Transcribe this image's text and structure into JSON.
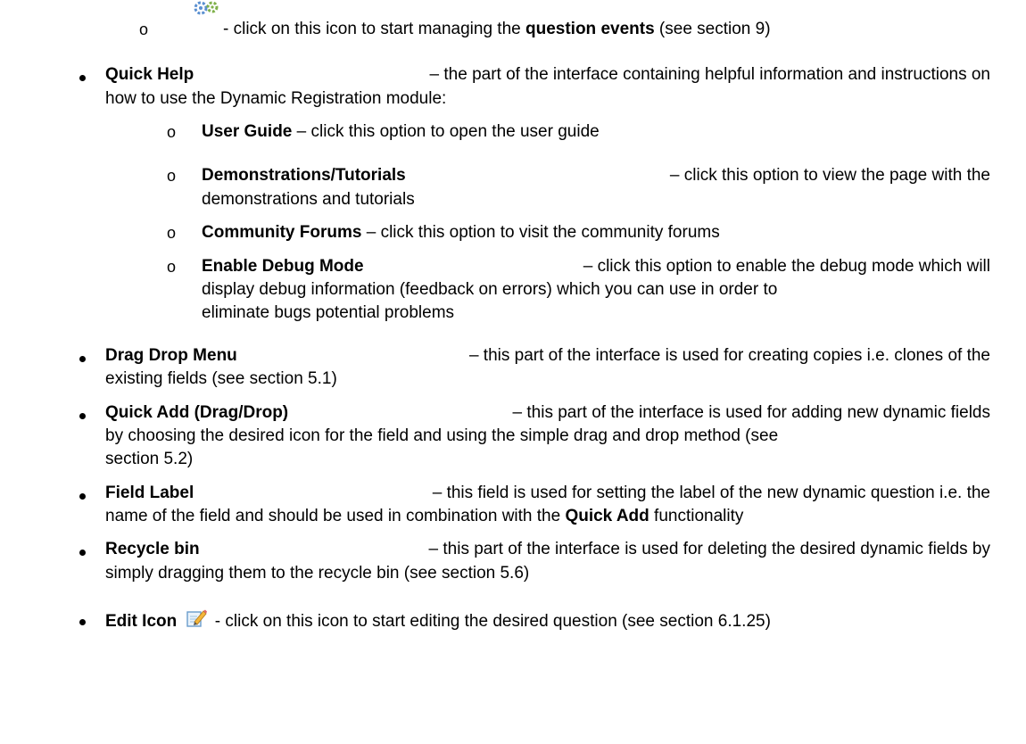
{
  "items": {
    "question_events": {
      "text": "- click on this icon to start managing the ",
      "bold": "question events",
      "tail": " (see section 9)"
    },
    "quick_help": {
      "title": "Quick Help",
      "line1": "– the part of the interface containing helpful information and instructions on",
      "line2": "how to use the Dynamic Registration module:",
      "subitems": {
        "user_guide": {
          "title": "User Guide",
          "text": "– click this option to open the user guide"
        },
        "demos": {
          "title": "Demonstrations/Tutorials",
          "line1": "– click this option to view the page with the",
          "line2": "demonstrations and tutorials"
        },
        "forums": {
          "title": "Community Forums",
          "text": "– click this option to visit the community forums"
        },
        "debug": {
          "title": "Enable Debug Mode",
          "line1": "– click this option to enable the debug mode which will",
          "line2": "display debug information (feedback on errors) which you can use in order to",
          "line3": "eliminate bugs potential problems"
        }
      }
    },
    "drag_drop": {
      "title": "Drag Drop Menu",
      "line1": "– this part of the interface is used for creating copies i.e. clones of the",
      "line2": "existing fields (see section 5.1)"
    },
    "quick_add": {
      "title": "Quick Add (Drag/Drop)",
      "line1": "– this part of the interface is used for adding new dynamic fields",
      "line2": "by choosing the desired icon for the field and using the simple drag and drop method (see",
      "line3": "section 5.2)"
    },
    "field_label": {
      "title": "Field Label",
      "line1": "– this field is used for setting the label of the new dynamic question i.e. the",
      "line2a": "name of the field and should be used in combination with the ",
      "line2b": "Quick Add",
      "line2c": " functionality"
    },
    "recycle_bin": {
      "title": "Recycle bin",
      "line1": "– this part of the interface is used for deleting the desired dynamic fields by",
      "line2": "simply dragging them to the recycle bin (see section 5.6)"
    },
    "edit_icon": {
      "title": "Edit Icon",
      "text": "- click on this icon to start editing the desired question (see section 6.1.25)"
    }
  },
  "icons": {
    "gears": "gears-icon",
    "edit": "edit-pencil-icon"
  }
}
